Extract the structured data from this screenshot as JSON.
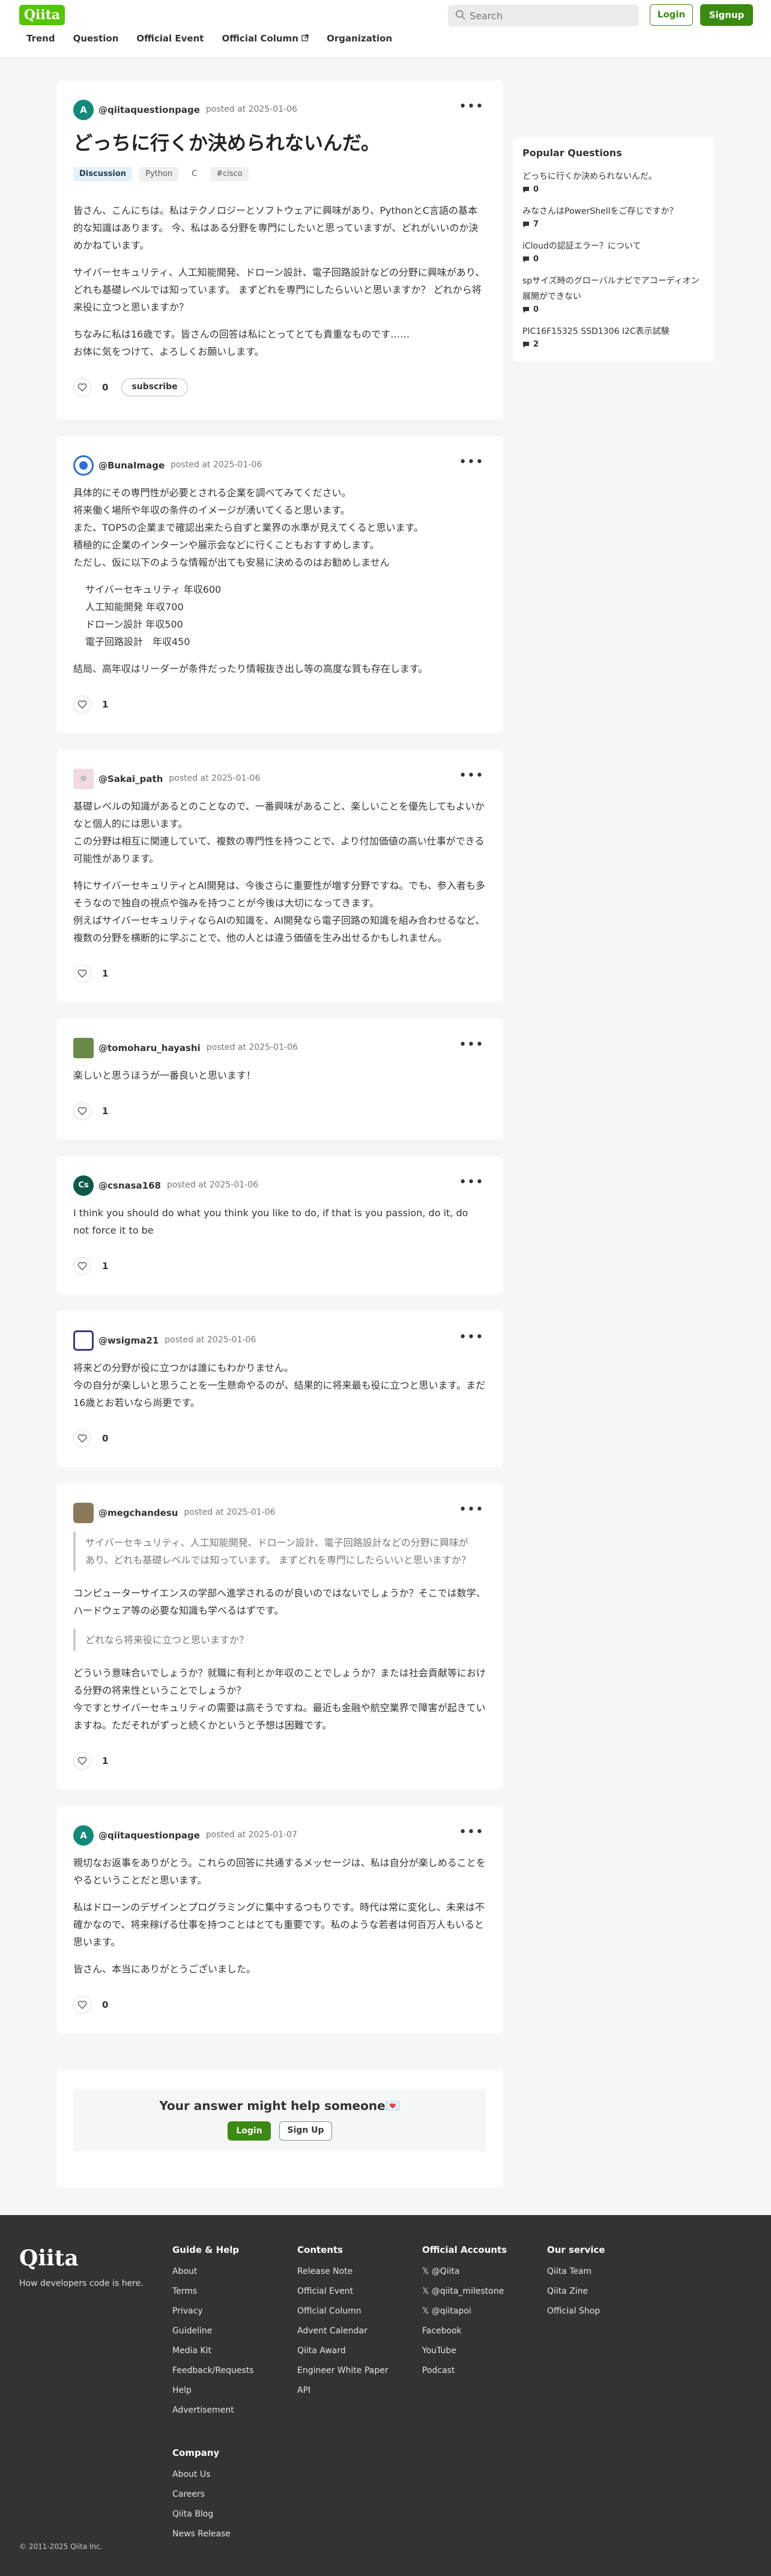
{
  "header": {
    "logo": "Qiita",
    "search_placeholder": "Search",
    "login": "Login",
    "signup": "Signup",
    "nav": [
      "Trend",
      "Question",
      "Official Event",
      "Official Column",
      "Organization"
    ]
  },
  "question": {
    "author": "@qiitaquestionpage",
    "posted": "posted at 2025-01-06",
    "title": "どっちに行くか決められないんだ。",
    "tags": [
      "Discussion",
      "Python",
      "C",
      "#cisco"
    ],
    "paragraphs": [
      "皆さん、こんにちは。私はテクノロジーとソフトウェアに興味があり、PythonとC言語の基本的な知識はあります。 今、私はある分野を専門にしたいと思っていますが、どれがいいのか決めかねています。",
      "サイバーセキュリティ、人工知能開発、ドローン設計、電子回路設計などの分野に興味があり、どれも基礎レベルでは知っています。 まずどれを専門にしたらいいと思いますか？ どれから将来役に立つと思いますか？",
      "ちなみに私は16歳です。皆さんの回答は私にとってとても貴重なものです……",
      "お体に気をつけて、よろしくお願いします。"
    ],
    "likes": "0",
    "subscribe": "subscribe"
  },
  "answers": [
    {
      "author": "@BunaImage",
      "posted": "posted at 2025-01-06",
      "paragraphs": [
        "具体的にその専門性が必要とされる企業を調べてみてください。",
        "将来働く場所や年収の条件のイメージが湧いてくると思います。",
        "また、TOP5の企業まで確認出来たら自ずと業界の水準が見えてくると思います。",
        "積極的に企業のインターンや展示会などに行くこともおすすめします。",
        "ただし、仮に以下のような情報が出ても安易に決めるのはお勧めしません"
      ],
      "list": [
        "サイバーセキュリティ 年収600",
        "人工知能開発 年収700",
        "ドローン設計 年収500",
        "電子回路設計　年収450"
      ],
      "closing": "結局、高年収はリーダーが条件だったり情報抜き出し等の高度な質も存在します。",
      "likes": "1"
    },
    {
      "author": "@Sakai_path",
      "posted": "posted at 2025-01-06",
      "p1": [
        "基礎レベルの知識があるとのことなので、一番興味があること、楽しいことを優先してもよいかなと個人的には思います。",
        "この分野は相互に関連していて、複数の専門性を持つことで、より付加価値の高い仕事ができる可能性があります。"
      ],
      "p2": [
        "特にサイバーセキュリティとAI開発は、今後さらに重要性が増す分野ですね。でも、参入者も多そうなので独自の視点や強みを持つことが今後は大切になってきます。",
        "例えばサイバーセキュリティならAIの知識を、AI開発なら電子回路の知識を組み合わせるなど、複数の分野を横断的に学ぶことで、他の人とは違う価値を生み出せるかもしれません。"
      ],
      "likes": "1"
    },
    {
      "author": "@tomoharu_hayashi",
      "posted": "posted at 2025-01-06",
      "text": "楽しいと思うほうが一番良いと思います！",
      "likes": "1"
    },
    {
      "author": "@csnasa168",
      "posted": "posted at 2025-01-06",
      "text": "I think you should do what you think you like to do, if that is you passion, do it, do not force it to be",
      "likes": "1"
    },
    {
      "author": "@wsigma21",
      "posted": "posted at 2025-01-06",
      "lines": [
        "将来どの分野が役に立つかは誰にもわかりません。",
        "今の自分が楽しいと思うことを一生懸命やるのが、結果的に将来最も役に立つと思います。まだ16歳とお若いなら尚更です。"
      ],
      "likes": "0"
    },
    {
      "author": "@megchandesu",
      "posted": "posted at 2025-01-06",
      "quote1": "サイバーセキュリティ、人工知能開発、ドローン設計、電子回路設計などの分野に興味があり、どれも基礎レベルでは知っています。 まずどれを専門にしたらいいと思いますか？",
      "p1": "コンピューターサイエンスの学部へ進学されるのが良いのではないでしょうか？そこでは数学、ハードウェア等の必要な知識も学べるはずです。",
      "quote2": "どれなら将来役に立つと思いますか？",
      "p2": [
        "どういう意味合いでしょうか？就職に有利とか年収のことでしょうか？または社会貢献等における分野の将来性ということでしょうか？",
        "今ですとサイバーセキュリティの需要は高そうですね。最近も金融や航空業界で障害が起きていますね。ただそれがずっと続くかというと予想は困難です。"
      ],
      "likes": "1"
    },
    {
      "author": "@qiitaquestionpage",
      "posted": "posted at 2025-01-07",
      "paragraphs": [
        "親切なお返事をありがとう。これらの回答に共通するメッセージは、私は自分が楽しめることをやるということだと思います。",
        "私はドローンのデザインとプログラミングに集中するつもりです。時代は常に変化し、未来は不確かなので、将来稼げる仕事を持つことはとても重要です。私のような若者は何百万人もいると思います。",
        "皆さん、本当にありがとうございました。"
      ],
      "likes": "0"
    }
  ],
  "popular": {
    "title": "Popular Questions",
    "items": [
      {
        "title": "どっちに行くか決められないんだ。",
        "count": "0"
      },
      {
        "title": "みなさんはPowerShellをご存じですか？",
        "count": "7"
      },
      {
        "title": "iCloudの認証エラー？について",
        "count": "0"
      },
      {
        "title": "spサイズ時のグローバルナビでアコーディオン展開ができない",
        "count": "0"
      },
      {
        "title": "PIC16F15325 SSD1306 I2C表示試験",
        "count": "2"
      }
    ]
  },
  "cta": {
    "title": "Your answer might help someone💌",
    "login": "Login",
    "signup": "Sign Up"
  },
  "footer": {
    "logo": "Qiita",
    "tagline": "How developers code is here.",
    "copyright": "© 2011-2025 Qiita Inc.",
    "guide": {
      "title": "Guide & Help",
      "links": [
        "About",
        "Terms",
        "Privacy",
        "Guideline",
        "Media Kit",
        "Feedback/Requests",
        "Help",
        "Advertisement"
      ]
    },
    "contents": {
      "title": "Contents",
      "links": [
        "Release Note",
        "Official Event",
        "Official Column",
        "Advent Calendar",
        "Qiita Award",
        "Engineer White Paper",
        "API"
      ]
    },
    "accounts": {
      "title": "Official Accounts",
      "links": [
        "@Qiita",
        "@qiita_milestone",
        "@qiitapoi",
        "Facebook",
        "YouTube",
        "Podcast"
      ]
    },
    "service": {
      "title": "Our service",
      "links": [
        "Qiita Team",
        "Qiita Zine",
        "Official Shop"
      ]
    },
    "company": {
      "title": "Company",
      "links": [
        "About Us",
        "Careers",
        "Qiita Blog",
        "News Release"
      ]
    }
  },
  "colors": {
    "brand": "#55c500",
    "button_green": "#3b8a12",
    "footer_bg": "#333333",
    "avatar_a": "#108a7b"
  }
}
